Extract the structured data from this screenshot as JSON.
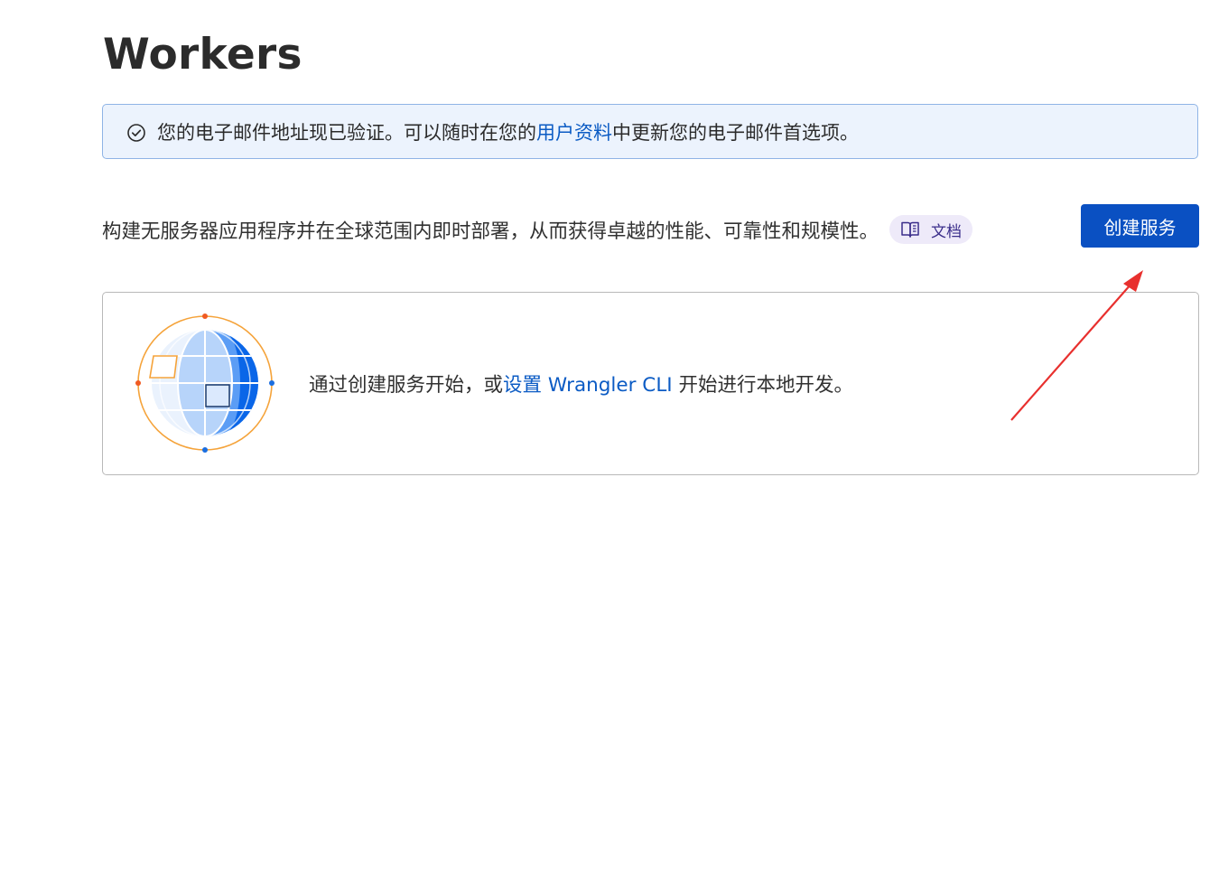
{
  "page": {
    "title": "Workers"
  },
  "banner": {
    "icon": "check-circle-icon",
    "text_before": "您的电子邮件地址现已验证。可以随时在您的",
    "link_text": "用户资料",
    "text_after": "中更新您的电子邮件首选项。"
  },
  "intro": {
    "text": "构建无服务器应用程序并在全球范围内即时部署，从而获得卓越的性能、可靠性和规模性。",
    "docs_label": "文档",
    "docs_icon": "book-icon"
  },
  "create_button": {
    "label": "创建服务"
  },
  "empty_state": {
    "illustration": "globe-icon",
    "text_before": "通过创建服务开始，或",
    "link_text": "设置 Wrangler CLI",
    "text_after": " 开始进行本地开发。"
  },
  "annotation": {
    "arrow_color": "#e8302e"
  },
  "colors": {
    "primary": "#0a50c2",
    "link": "#0b5bc4",
    "banner_bg": "#ecf3fd",
    "banner_border": "#8fb4e6",
    "globe_orbit": "#f5a33a"
  }
}
